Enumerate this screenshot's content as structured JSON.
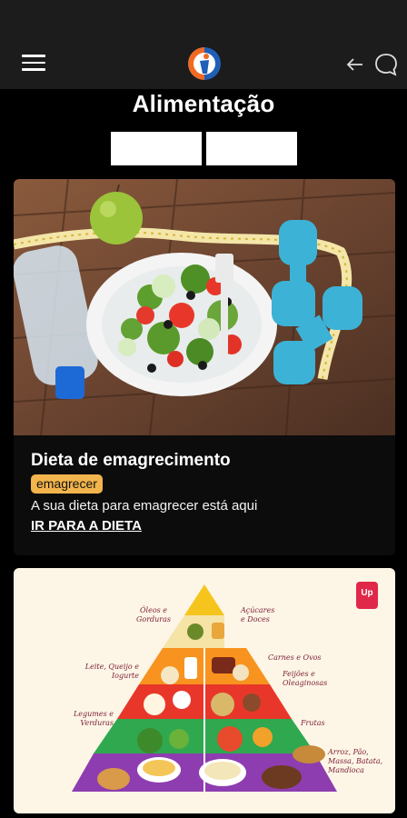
{
  "header": {
    "menu_icon": "hamburger-menu-icon",
    "logo_icon": "app-logo-icon",
    "back_icon": "arrow-left-icon",
    "chat_icon": "chat-bubble-icon"
  },
  "page": {
    "title": "Alimentação",
    "tabs": [
      "",
      ""
    ]
  },
  "cards": [
    {
      "image": "salad-dumbbells-water-photo",
      "title": "Dieta de emagrecimento",
      "tag": "emagrecer",
      "description": "A sua dieta para emagrecer está aqui",
      "link": "IR PARA A DIETA"
    },
    {
      "image": "food-pyramid-illustration",
      "badge": "Up",
      "labels": {
        "oils": "Óleos e Gorduras",
        "sugars": "Açúcares e Doces",
        "meats": "Carnes e Ovos",
        "dairy": "Leite, Queijo e Iogurte",
        "beans": "Feijões e Oleaginosas",
        "vegetables": "Legumes e Verduras",
        "fruits": "Frutas",
        "grains": "Arroz, Pão, Massa, Batata, Mandioca"
      }
    }
  ],
  "colors": {
    "background": "#000000",
    "appbar": "#1c1c1c",
    "tag": "#f2b44c",
    "pyramid_text": "#7d2035"
  }
}
